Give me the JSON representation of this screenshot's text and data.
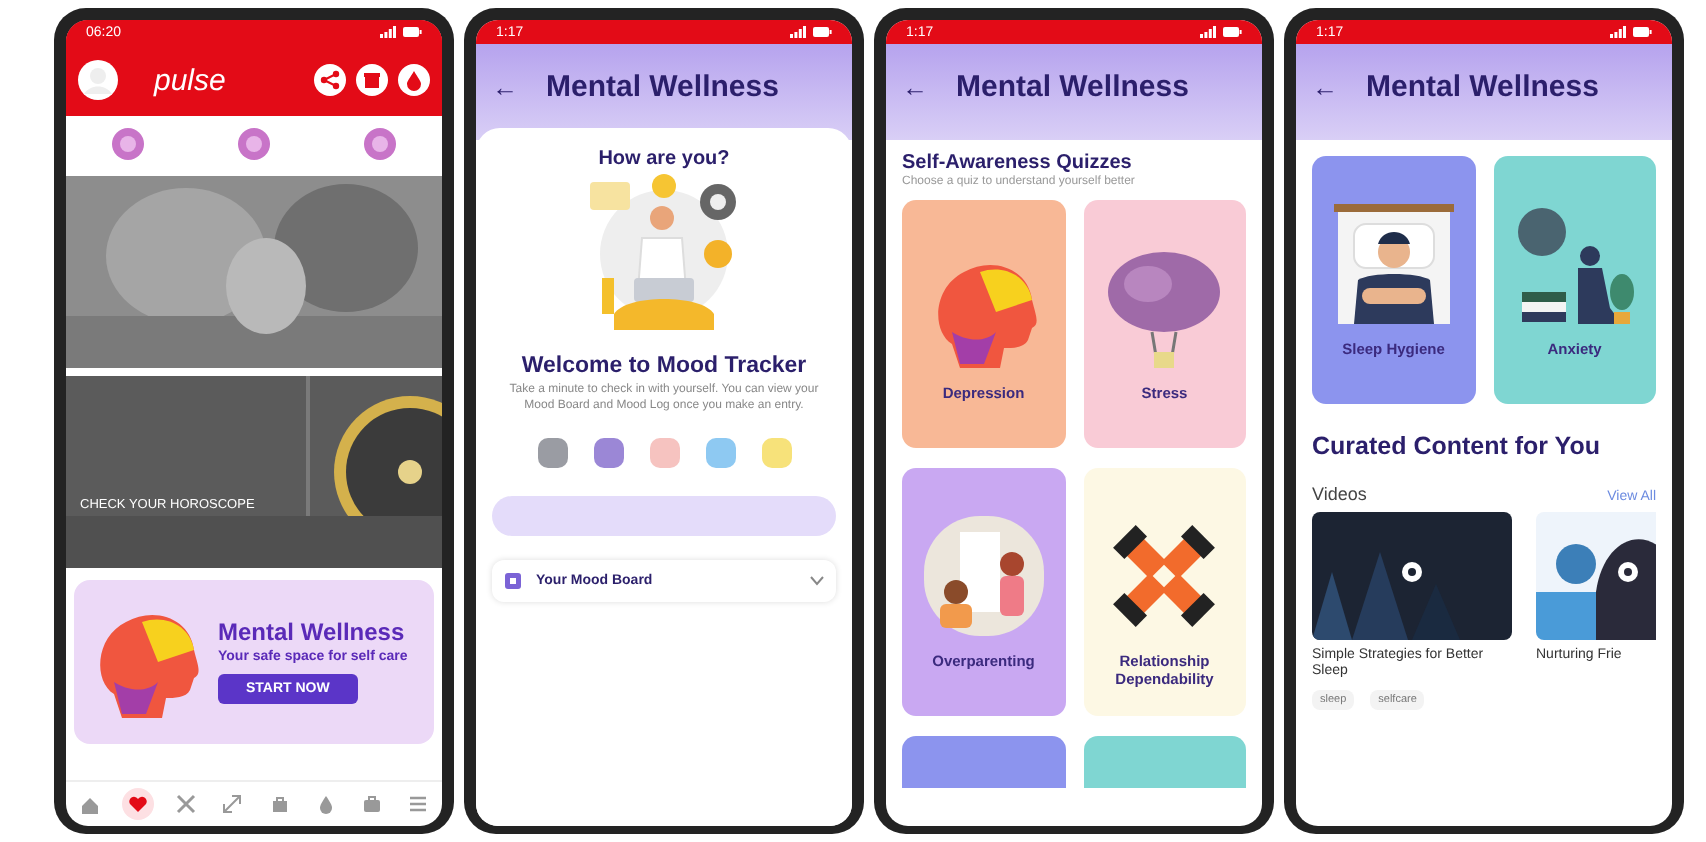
{
  "phones": [
    {
      "kind": "home",
      "status_time": "06:20",
      "logo": "pulse",
      "banners": [
        {
          "kind": "picture"
        },
        {
          "kind": "picture",
          "title": "CHECK YOUR HOROSCOPE"
        }
      ],
      "promo": {
        "title": "Mental Wellness",
        "subtitle": "Your safe space for self care",
        "button": "START NOW"
      },
      "nav": [
        {
          "selected": false
        },
        {
          "selected": true
        },
        {
          "selected": false
        },
        {
          "selected": false
        },
        {
          "selected": false
        },
        {
          "selected": false
        },
        {
          "selected": false
        },
        {
          "selected": false
        }
      ]
    },
    {
      "kind": "mood",
      "status_time": "1:17",
      "back": "←",
      "title": "Mental Wellness",
      "question": "How are you?",
      "heading": "Welcome to Mood Tracker",
      "description": "Take a minute to check in with yourself. You can view your Mood Board and Mood Log once you make an entry.",
      "moods": [
        {
          "color": "#9a9ca3"
        },
        {
          "color": "#9b87d6"
        },
        {
          "color": "#f6c3c0"
        },
        {
          "color": "#8ec9f2"
        },
        {
          "color": "#f7e27a"
        }
      ],
      "board": "Your Mood Board"
    },
    {
      "kind": "quizzes",
      "status_time": "1:17",
      "back": "←",
      "title": "Mental Wellness",
      "section": "Self-Awareness Quizzes",
      "hint": "Choose a quiz to understand yourself better",
      "cards": [
        {
          "label": "Depression",
          "color": "#f8b896",
          "kind": "head"
        },
        {
          "label": "Stress",
          "color": "#f9cbd6",
          "kind": "brain"
        },
        {
          "label": "Overparenting",
          "color": "#c9a8f2",
          "kind": "family"
        },
        {
          "label": "Relationship Dependability",
          "color": "#fdf8e4",
          "kind": "hands"
        },
        {
          "color": "#8c94ee",
          "kind": "blank"
        },
        {
          "color": "#7fd6d2",
          "kind": "blank"
        }
      ]
    },
    {
      "kind": "content",
      "status_time": "1:17",
      "back": "←",
      "title": "Mental Wellness",
      "cards": [
        {
          "label": "Sleep Hygiene",
          "color": "#8c94ee",
          "kind": "sleeper"
        },
        {
          "label": "Anxiety",
          "color": "#7fd6d2",
          "kind": "thinker"
        }
      ],
      "section": "Curated Content for You",
      "videos_title": "Videos",
      "view_all": "View All",
      "videos": [
        {
          "title": "Simple Strategies for Better Sleep",
          "tags": [
            "sleep",
            "selfcare"
          ]
        },
        {
          "title": "Nurturing Frie"
        }
      ]
    }
  ]
}
